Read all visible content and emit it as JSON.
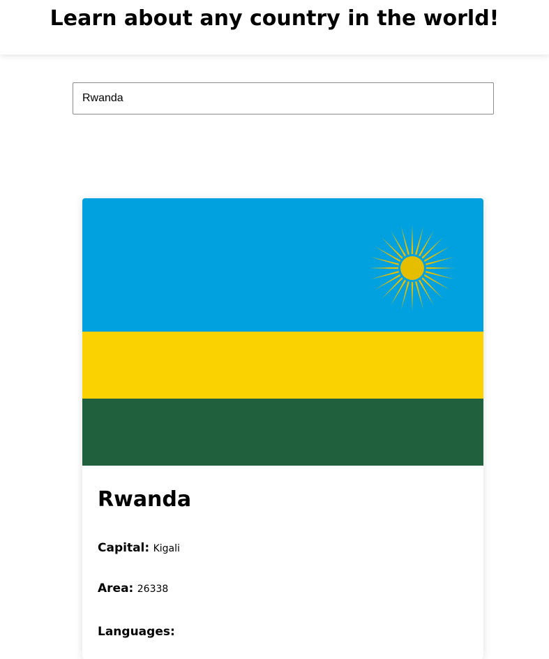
{
  "header": {
    "title": "Learn about any country in the world!"
  },
  "search": {
    "value": "Rwanda",
    "placeholder": ""
  },
  "country": {
    "name": "Rwanda",
    "capital_label": "Capital:",
    "capital": "Kigali",
    "area_label": "Area:",
    "area": "26338",
    "languages_label": "Languages:",
    "flag": {
      "icon": "rwanda-flag",
      "colors": {
        "blue": "#00A1DE",
        "yellow": "#FAD201",
        "green": "#20603D",
        "sun": "#E5BE01"
      }
    }
  }
}
